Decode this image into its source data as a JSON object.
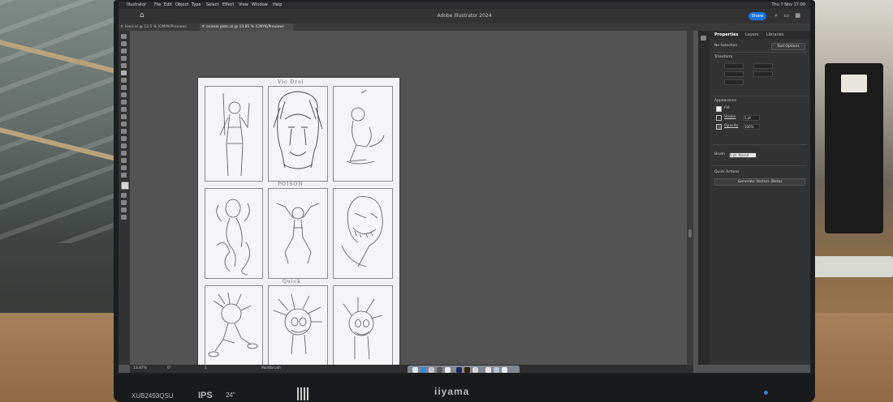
{
  "environment": {
    "monitor_brand": "iiyama",
    "monitor_model": "XUB2493QSU",
    "panel_type": "IPS",
    "screen_size": "24\""
  },
  "mac_menu": {
    "items": [
      "Illustrator",
      "File",
      "Edit",
      "Object",
      "Type",
      "Select",
      "Effect",
      "View",
      "Window",
      "Help"
    ],
    "clock": "Thu 7 Nov 17:00"
  },
  "app": {
    "title": "Adobe Illustrator 2024",
    "share_label": "Share"
  },
  "tabs": [
    {
      "label": "Hero.ai @ 12.5 % (CMYK/Preview)",
      "active": false
    },
    {
      "label": "animal plots.ai @ 13.85 % (CMYK/Preview)",
      "active": true
    }
  ],
  "artboard": {
    "row_labels": [
      "Vic Drol",
      "POISON",
      "Quick"
    ]
  },
  "status": {
    "zoom": "13.87%",
    "rotation": "0°",
    "page": "1",
    "tool": "Paintbrush"
  },
  "panel": {
    "tabs": [
      "Properties",
      "Layers",
      "Libraries"
    ],
    "selection": "No Selection",
    "tool_options": "Tool Options",
    "transform_label": "Transform",
    "appearance_label": "Appearance",
    "fill_label": "Fill",
    "stroke_label": "Stroke",
    "stroke_value": "1 pt",
    "opacity_label": "Opacity",
    "opacity_value": "100%",
    "brush_label": "Brush",
    "brush_value": "5 pt. Round",
    "quick_actions_label": "Quick Actions",
    "generate_button": "Generate Vectors (Beta)"
  }
}
